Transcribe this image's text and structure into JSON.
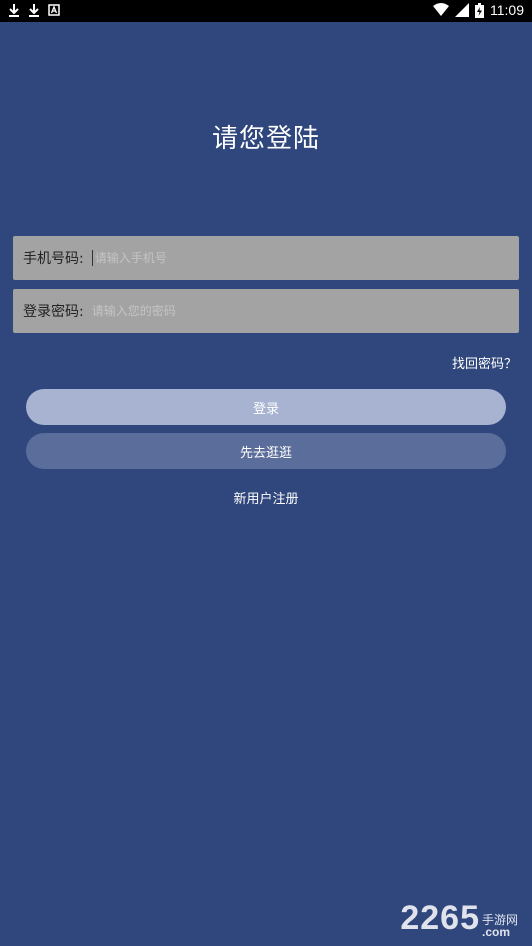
{
  "status_bar": {
    "left_icons": [
      "download-icon",
      "download-icon",
      "notification-a-icon"
    ],
    "right_icons": [
      "wifi-icon",
      "signal-icon",
      "battery-icon"
    ],
    "time": "11:09"
  },
  "page": {
    "title": "请您登陆",
    "background": "#30477d"
  },
  "form": {
    "phone": {
      "label": "手机号码:",
      "placeholder": "请输入手机号",
      "value": ""
    },
    "password": {
      "label": "登录密码:",
      "placeholder": "请输入您的密码",
      "value": ""
    },
    "forgot_label": "找回密码？"
  },
  "buttons": {
    "login_label": "登录",
    "browse_label": "先去逛逛",
    "register_label": "新用户注册"
  },
  "watermark": {
    "number": "2265",
    "cn": "手游网",
    "suffix": ".com"
  }
}
